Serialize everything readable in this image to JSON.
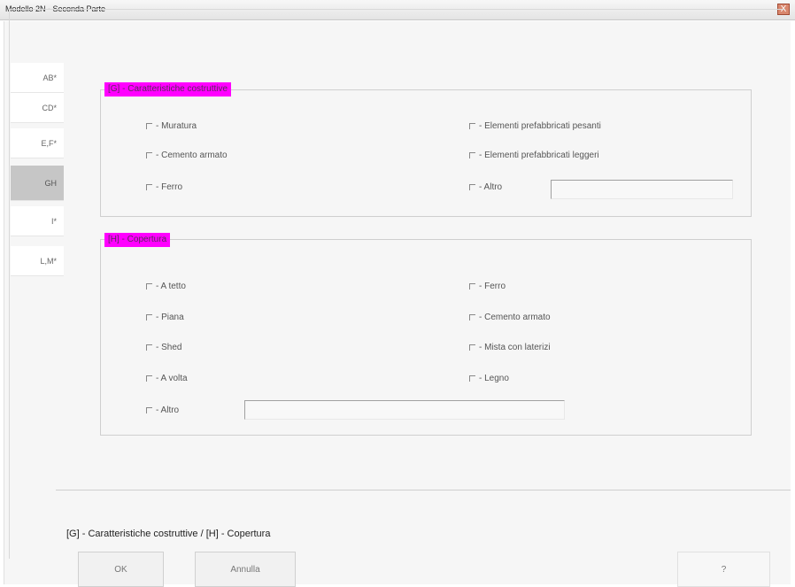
{
  "window": {
    "title": "Modello 2N - Seconda Parte",
    "close_label": "X"
  },
  "tabs": [
    {
      "label": "AB*"
    },
    {
      "label": "CD*"
    },
    {
      "label": "E,F*"
    },
    {
      "label": "GH"
    },
    {
      "label": "I*"
    },
    {
      "label": "L,M*"
    }
  ],
  "group_g": {
    "title": "[G] - Caratteristiche costruttive",
    "options": [
      {
        "label": "- Muratura"
      },
      {
        "label": "- Cemento armato"
      },
      {
        "label": "- Ferro"
      },
      {
        "label": "- Elementi prefabbricati pesanti"
      },
      {
        "label": "- Elementi prefabbricati leggeri"
      },
      {
        "label": "- Altro"
      }
    ],
    "altro_value": ""
  },
  "group_h": {
    "title": "[H] - Copertura",
    "options": [
      {
        "label": "- A tetto"
      },
      {
        "label": "- Piana"
      },
      {
        "label": "- Shed"
      },
      {
        "label": "- A volta"
      },
      {
        "label": "- Altro"
      },
      {
        "label": "- Ferro"
      },
      {
        "label": "- Cemento armato"
      },
      {
        "label": "- Mista con laterizi"
      },
      {
        "label": "- Legno"
      }
    ],
    "altro_value": ""
  },
  "status_text": "[G] - Caratteristiche costruttive / [H] - Copertura",
  "buttons": {
    "ok": "OK",
    "cancel": "Annulla",
    "help": "?"
  }
}
